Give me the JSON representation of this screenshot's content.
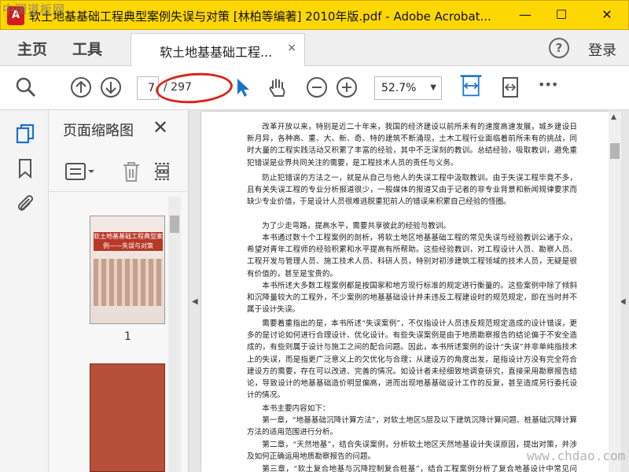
{
  "window": {
    "title": "软土地基基础工程典型案例失误与对策 [林柏等编著] 2010年版.pdf - Adobe Acrobat...",
    "app_icon_letter": "A",
    "minimize_glyph": "—",
    "maximize_glyph": "☐",
    "close_glyph": "✕"
  },
  "watermarks": {
    "top_left": "中国道板网",
    "bottom_right": "www.chdao.com"
  },
  "tabs": {
    "home": "主页",
    "tools": "工具",
    "document": "软土地基基础工程...",
    "close_glyph": "×",
    "help_glyph": "?",
    "login": "登录"
  },
  "toolbar": {
    "page_current": "7",
    "page_total": "/ 297",
    "zoom": "52.7%",
    "more_glyph": "•••"
  },
  "thumbnails": {
    "header": "页面缩略图",
    "close_glyph": "✕",
    "page1_label": "1",
    "cover_title": "软土地基基础工程典型案例——失误与对策"
  },
  "document": {
    "paragraphs": [
      "改革开放以来，特别是近二十年来，我国的经济建设以前所未有的速度高速发展，城乡建设日新月异，各种高、重、大、新、奇、特的建筑不断涌现，土木工程行业面临着前所未有的挑战，同时大量的工程实践活动又积累了丰富的经验，其中不乏深刻的教训。总结经验，吸取教训，避免重犯错误是业界共同关注的需要，是工程技术人员的责任与义务。",
      "防止犯错误的方法之一，就是从自己与他人的失误工程中汲取教训。由于失误工程毕竟不多，且有关失误工程的专业分析报道很少，一般媒体的报道又由于记者的非专业背景和新闻规律要求而缺少专业价值，于是设计人员很难逃脱重犯前人的错误来积累自己经验的怪圈。",
      "为了少走弯路，提高水平，需要共享彼此的经验与教训。",
      "本书通过数十个工程案例的剖析，将软土地区地基基础工程的常见失误与经验教训公诸于众，希望对青年工程师的经验积累和水平提高有所帮助。这些经验教训，对工程设计人员、勘察人员、工程开发与管理人员、施工技术人员、科研人员，特别对初涉建筑工程领域的技术人员，无疑是很有价值的，甚至是宝贵的。",
      "本书所述大多数工程案例都是按国家和地方现行标准的规定进行衡量的。这些案例中除了倾斜和沉降量较大的工程外，不少案例的地基基础设计并未违反工程建设时的规范规定，即在当时并不属于设计失误。",
      "需要着重指出的是，本书所述“失误案例”，不仅指设计人员违反规范规定造成的设计错误，更多的是讨论如何进行合理设计、优化设计。有些失误案例是由于地质勘察报告的结论偏于不安全造成的，有些则属于设计与施工之间的配合问题。因此，本书所述案例的设计“失误”并非单纯指技术上的失误，而是指更广泛意义上的欠优化与合理；从建设方的角度出发，是指设计方没有完全符合建设方的需要，存在可以改进、完善的情况。如设计者未经细致地调查研究，直接采用勘察报告结论，导致设计的地基基础造价明显偏高，进而出现地基基础设计工作的反复，甚至造成另行委托设计的情况。",
      "本书主要内容如下：",
      "第一章，“地基基础沉降计算方法”，对软土地区5层及以下建筑沉降计算问题、桩基础沉降计算方法的适用范围进行分析。",
      "第二章，“天然地基”，结合失误案例，分析软土地区天然地基设计失误原因，提出对策，并涉及如何正确运用地质勘察报告的问题。",
      "第三章，“软土复合地基与沉降控制复合桩基”，结合工程案例分析了复合地基设计中常见问题。"
    ]
  }
}
